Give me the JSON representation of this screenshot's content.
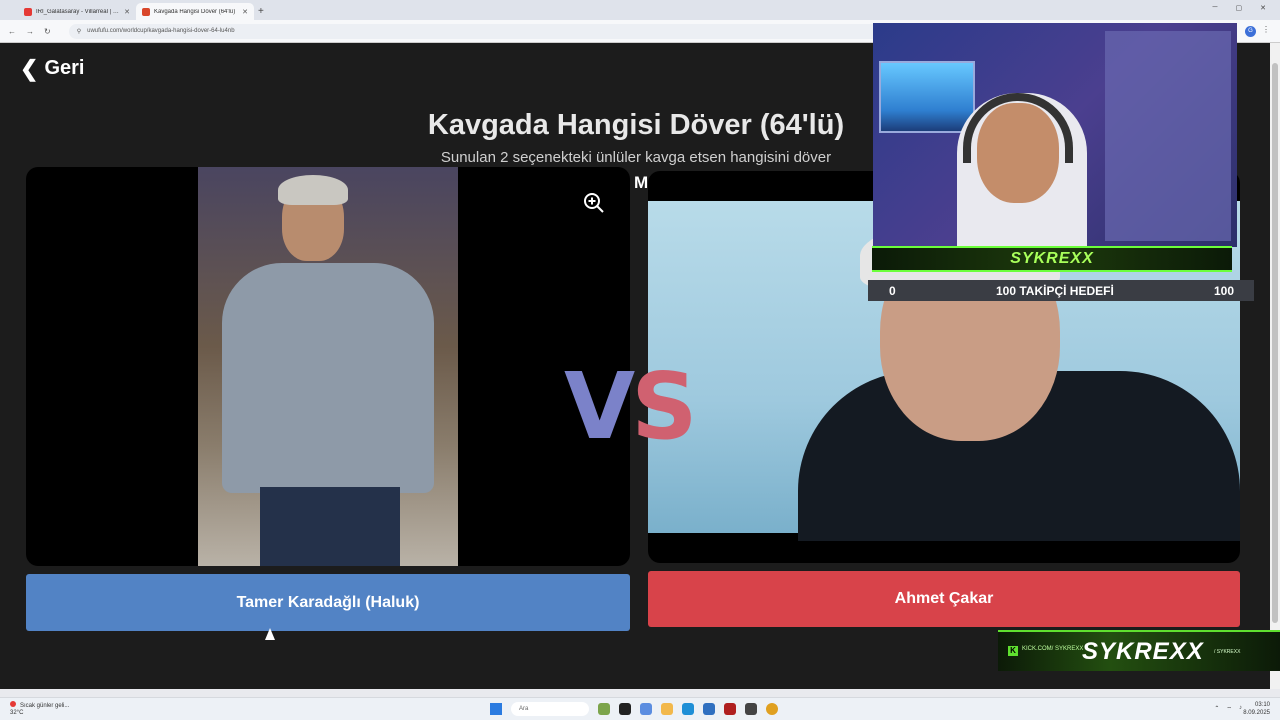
{
  "browser": {
    "tabs": [
      {
        "title": "İRİ_Galatasaray - Villarreal | Ha",
        "active": false
      },
      {
        "title": "Kavgada Hangisi Döver (64'lü)",
        "active": true
      }
    ],
    "new_tab": "+",
    "url": "uwufufu.com/worldcup/kavgada-hangisi-dover-64-lu4nb",
    "profile_initial": "G"
  },
  "page": {
    "back_label": "Geri",
    "title": "Kavgada Hangisi Döver (64'lü)",
    "subtitle": "Sunulan 2 seçenekteki ünlüler kavga etsen hangisini döver",
    "partial_text": "M",
    "vs_v": "V",
    "vs_s": "S",
    "left_choice": "Tamer Karadağlı (Haluk)",
    "right_choice": "Ahmet Çakar",
    "colors": {
      "left_button": "#5283c5",
      "right_button": "#d8434a",
      "background": "#1c1c1c"
    }
  },
  "stream": {
    "banner_name": "SYKREXX",
    "goal_start": "0",
    "goal_title": "100 TAKİPÇİ HEDEFİ",
    "goal_end": "100",
    "social_brand": "SYKREXX",
    "social_kick_label": "KICK.COM/ SYKREXX",
    "social_handle": "/ SYKREXX",
    "accent": "#6cff3a"
  },
  "taskbar": {
    "weather_line1": "Sıcak günler geli...",
    "weather_line2": "32°C",
    "search_placeholder": "Ara",
    "time": "03:10",
    "date": "8.09.2025"
  }
}
